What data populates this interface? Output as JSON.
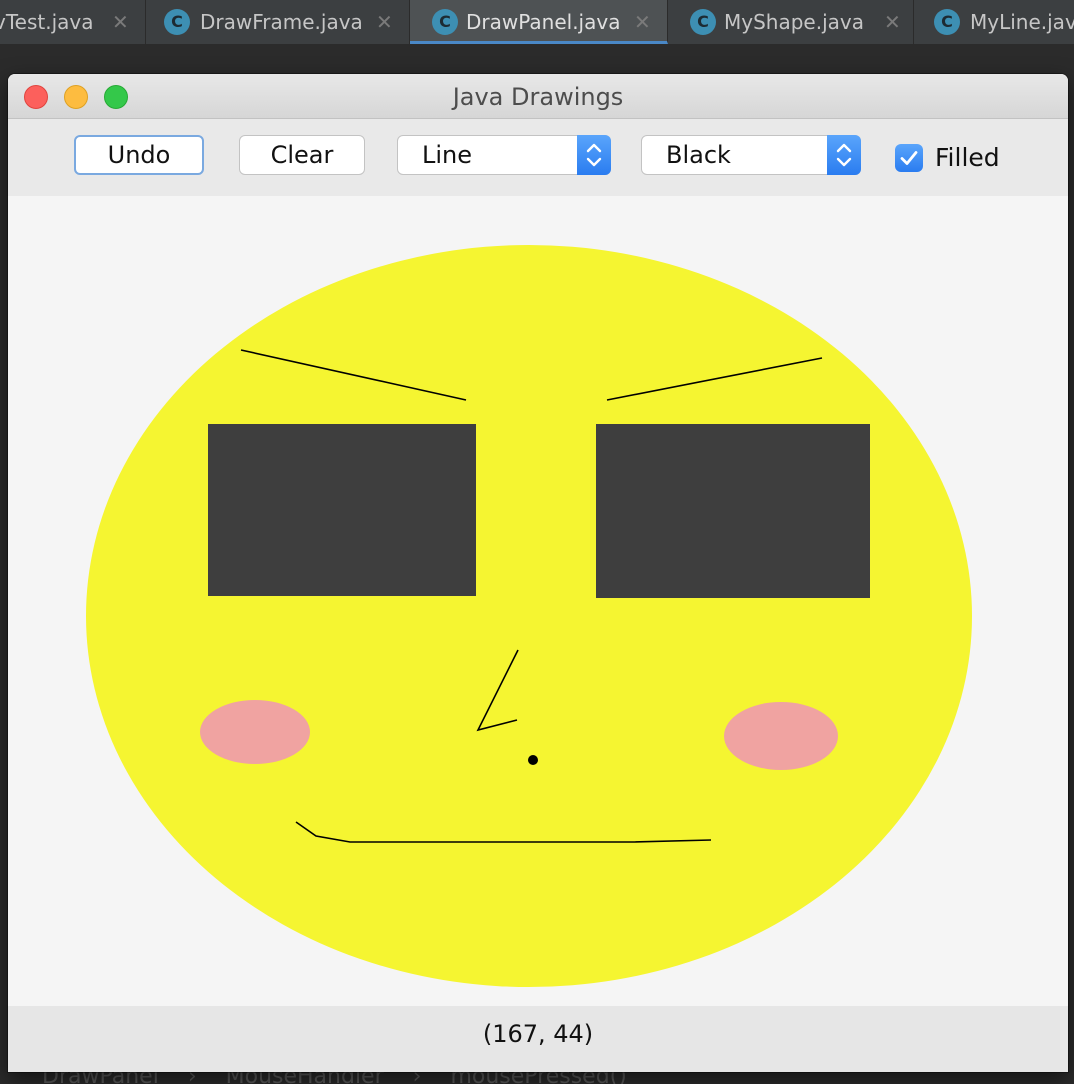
{
  "ide": {
    "tabs": [
      {
        "label": "vTest.java",
        "active": false
      },
      {
        "label": "DrawFrame.java",
        "active": false
      },
      {
        "label": "DrawPanel.java",
        "active": true
      },
      {
        "label": "MyShape.java",
        "active": false
      },
      {
        "label": "MyLine.java",
        "active": false
      }
    ],
    "class_icon": "C",
    "close_glyph": "✕",
    "code_brace": "{",
    "breadcrumb": [
      "DrawPanel",
      "MouseHandler",
      "mousePressed()"
    ]
  },
  "window": {
    "title": "Java Drawings"
  },
  "toolbar": {
    "undo_label": "Undo",
    "clear_label": "Clear",
    "shape_select": {
      "selected": "Line"
    },
    "color_select": {
      "selected": "Black"
    },
    "filled": {
      "label": "Filled",
      "checked": true
    }
  },
  "status": {
    "mouse_position": "(167, 44)"
  },
  "colors": {
    "face": "#f5f531",
    "glasses": "#3e3e3e",
    "cheeks": "#f0a3a1",
    "lines": "#000000",
    "accent": "#2a7cf0"
  }
}
